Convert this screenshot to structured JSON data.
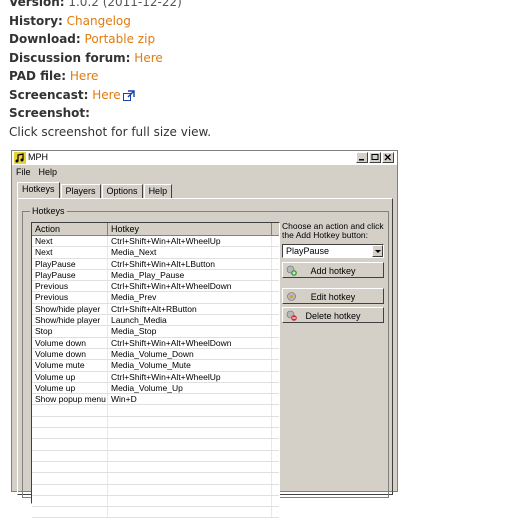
{
  "info": {
    "version_label": "Version:",
    "version_value": "1.0.2 (2011-12-22)",
    "history_label": "History:",
    "history_link": "Changelog",
    "download_label": "Download:",
    "download_link": "Portable zip",
    "forum_label": "Discussion forum:",
    "forum_link": "Here",
    "pad_label": "PAD file:",
    "pad_link": "Here",
    "screencast_label": "Screencast:",
    "screencast_link": "Here",
    "screenshot_label": "Screenshot:",
    "screenshot_note": "Click screenshot for full size view."
  },
  "window": {
    "title": "MPH",
    "menu": [
      "File",
      "Help"
    ],
    "tabs": [
      "Hotkeys",
      "Players",
      "Options",
      "Help"
    ],
    "group_label": "Hotkeys",
    "columns": [
      "Action",
      "Hotkey"
    ],
    "rows": [
      {
        "action": "Next",
        "hotkey": "Ctrl+Shift+Win+Alt+WheelUp"
      },
      {
        "action": "Next",
        "hotkey": "Media_Next"
      },
      {
        "action": "PlayPause",
        "hotkey": "Ctrl+Shift+Win+Alt+LButton"
      },
      {
        "action": "PlayPause",
        "hotkey": "Media_Play_Pause"
      },
      {
        "action": "Previous",
        "hotkey": "Ctrl+Shift+Win+Alt+WheelDown"
      },
      {
        "action": "Previous",
        "hotkey": "Media_Prev"
      },
      {
        "action": "Show/hide player",
        "hotkey": "Ctrl+Shift+Alt+RButton"
      },
      {
        "action": "Show/hide player",
        "hotkey": "Launch_Media"
      },
      {
        "action": "Stop",
        "hotkey": "Media_Stop"
      },
      {
        "action": "Volume down",
        "hotkey": "Ctrl+Shift+Win+Alt+WheelDown"
      },
      {
        "action": "Volume down",
        "hotkey": "Media_Volume_Down"
      },
      {
        "action": "Volume mute",
        "hotkey": "Media_Volume_Mute"
      },
      {
        "action": "Volume up",
        "hotkey": "Ctrl+Shift+Win+Alt+WheelUp"
      },
      {
        "action": "Volume up",
        "hotkey": "Media_Volume_Up"
      },
      {
        "action": "Show popup menu",
        "hotkey": "Win+D"
      }
    ],
    "empty_rows": 10,
    "instruction": "Choose an action and click the Add Hotkey button:",
    "selected_action": "PlayPause",
    "add_button": "Add hotkey",
    "edit_button": "Edit hotkey",
    "delete_button": "Delete hotkey"
  },
  "colors": {
    "link": "#e07b10",
    "chrome": "#d4d0c8"
  }
}
